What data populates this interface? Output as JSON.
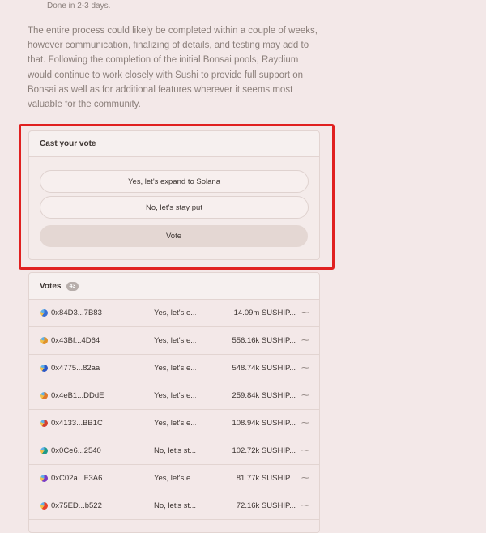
{
  "proposal": {
    "bullet_tail": "Done in 2-3 days.",
    "paragraph": "The entire process could likely be completed within a couple of weeks, however communication, finalizing of details, and testing may add to that. Following the completion of the initial Bonsai pools, Raydium would continue to work closely with Sushi to provide full support on Bonsai as well as for additional features wherever it seems most valuable for the community."
  },
  "cast_vote": {
    "title": "Cast your vote",
    "choices": [
      "Yes, let's expand to Solana",
      "No, let's stay put"
    ],
    "vote_button": "Vote"
  },
  "votes": {
    "title": "Votes",
    "count": "43",
    "rows": [
      {
        "address": "0x84D3...7B83",
        "choice": "Yes, let's e...",
        "power": "14.09m SUSHIP...",
        "avatar_color": "#3b6fd1"
      },
      {
        "address": "0x43Bf...4D64",
        "choice": "Yes, let's e...",
        "power": "556.16k SUSHIP...",
        "avatar_color": "#e0932a"
      },
      {
        "address": "0x4775...82aa",
        "choice": "Yes, let's e...",
        "power": "548.74k SUSHIP...",
        "avatar_color": "#2c58c4"
      },
      {
        "address": "0x4eB1...DDdE",
        "choice": "Yes, let's e...",
        "power": "259.84k SUSHIP...",
        "avatar_color": "#e07a2c"
      },
      {
        "address": "0x4133...BB1C",
        "choice": "Yes, let's e...",
        "power": "108.94k SUSHIP...",
        "avatar_color": "#d3402f"
      },
      {
        "address": "0x0Ce6...2540",
        "choice": "No, let's st...",
        "power": "102.72k SUSHIP...",
        "avatar_color": "#1f9a8a"
      },
      {
        "address": "0xC02a...F3A6",
        "choice": "Yes, let's e...",
        "power": "81.77k SUSHIP...",
        "avatar_color": "#7a3cc4"
      },
      {
        "address": "0x75ED...b522",
        "choice": "No, let's st...",
        "power": "72.16k SUSHIP...",
        "avatar_color": "#e8432b"
      }
    ],
    "signature_icon": "signature-icon"
  },
  "colors": {
    "highlight_frame": "#e02020",
    "background": "#f3e8e8"
  }
}
